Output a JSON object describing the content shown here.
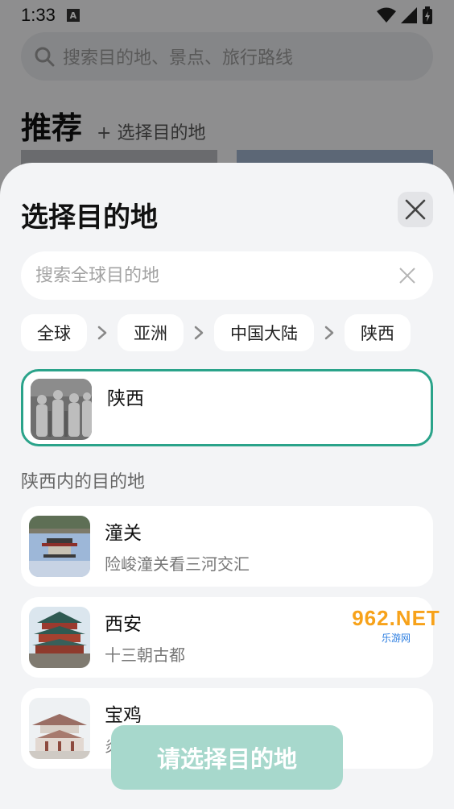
{
  "status": {
    "time": "1:33",
    "a_badge": "A"
  },
  "background": {
    "search_placeholder": "搜索目的地、景点、旅行路线",
    "recommend_title": "推荐",
    "recommend_add": "+ 选择目的地"
  },
  "sheet": {
    "title": "选择目的地",
    "search_placeholder": "搜索全球目的地",
    "breadcrumbs": [
      "全球",
      "亚洲",
      "中国大陆",
      "陕西"
    ],
    "selected": {
      "name": "陕西",
      "subtitle": ""
    },
    "section_label": "陕西内的目的地",
    "items": [
      {
        "name": "潼关",
        "subtitle": "险峻潼关看三河交汇"
      },
      {
        "name": "西安",
        "subtitle": "十三朝古都"
      },
      {
        "name": "宝鸡",
        "subtitle": "炎"
      }
    ],
    "cta_label": "请选择目的地"
  },
  "watermark": {
    "main": "962.NET",
    "sub": "乐游网"
  },
  "colors": {
    "accent": "#2aa38a",
    "cta": "#a7d8cc",
    "sheet_bg": "#f3f4f6"
  }
}
